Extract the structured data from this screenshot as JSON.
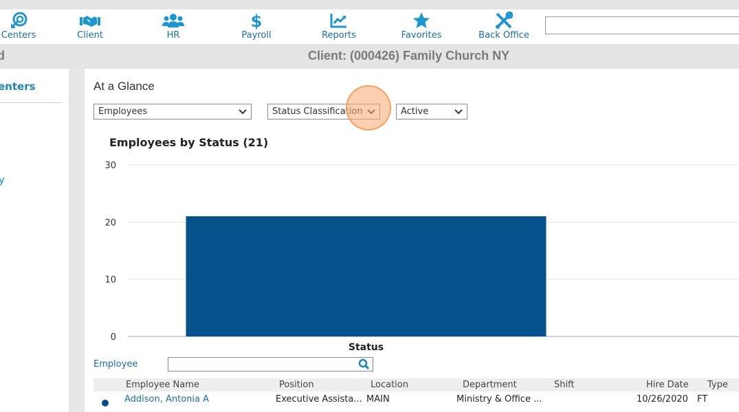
{
  "navbar": {
    "items": [
      {
        "label": "Centers",
        "icon": "target-arrow-icon"
      },
      {
        "label": "Client",
        "icon": "handshake-icon"
      },
      {
        "label": "HR",
        "icon": "users-icon"
      },
      {
        "label": "Payroll",
        "icon": "dollar-icon"
      },
      {
        "label": "Reports",
        "icon": "chart-line-icon"
      },
      {
        "label": "Favorites",
        "icon": "star-icon"
      },
      {
        "label": "Back Office",
        "icon": "tools-icon"
      }
    ],
    "search_value": ""
  },
  "client_bar": {
    "left_fragment": "d",
    "title": "Client: (000426) Family Church NY"
  },
  "sidebar": {
    "heading": "enters",
    "link_fragment": "y"
  },
  "main": {
    "title": "At a Glance",
    "filters": {
      "dataset": "Employees",
      "group_by": "Status Classification",
      "status": "Active"
    },
    "employee_filter": {
      "label": "Employee",
      "value": ""
    },
    "table": {
      "columns": [
        "Employee Name",
        "Position",
        "Location",
        "Department",
        "Shift",
        "Hire Date",
        "Type"
      ],
      "rows": [
        {
          "name": "Addison, Antonia A",
          "position": "Executive Assista...",
          "location": "MAIN",
          "department": "Ministry & Office ...",
          "shift": "",
          "hire_date": "10/26/2020",
          "type": "FT"
        }
      ]
    }
  },
  "colors": {
    "accent": "#1f84b4",
    "bar": "#05518b",
    "link": "#1f6e99"
  },
  "chart_data": {
    "type": "bar",
    "title": "Employees by Status (21)",
    "categories": [
      "Status"
    ],
    "values": [
      21
    ],
    "xlabel": "Status",
    "ylabel": "",
    "ylim": [
      0,
      30
    ],
    "yticks": [
      0,
      10,
      20,
      30
    ],
    "grid": true,
    "legend": "none"
  }
}
